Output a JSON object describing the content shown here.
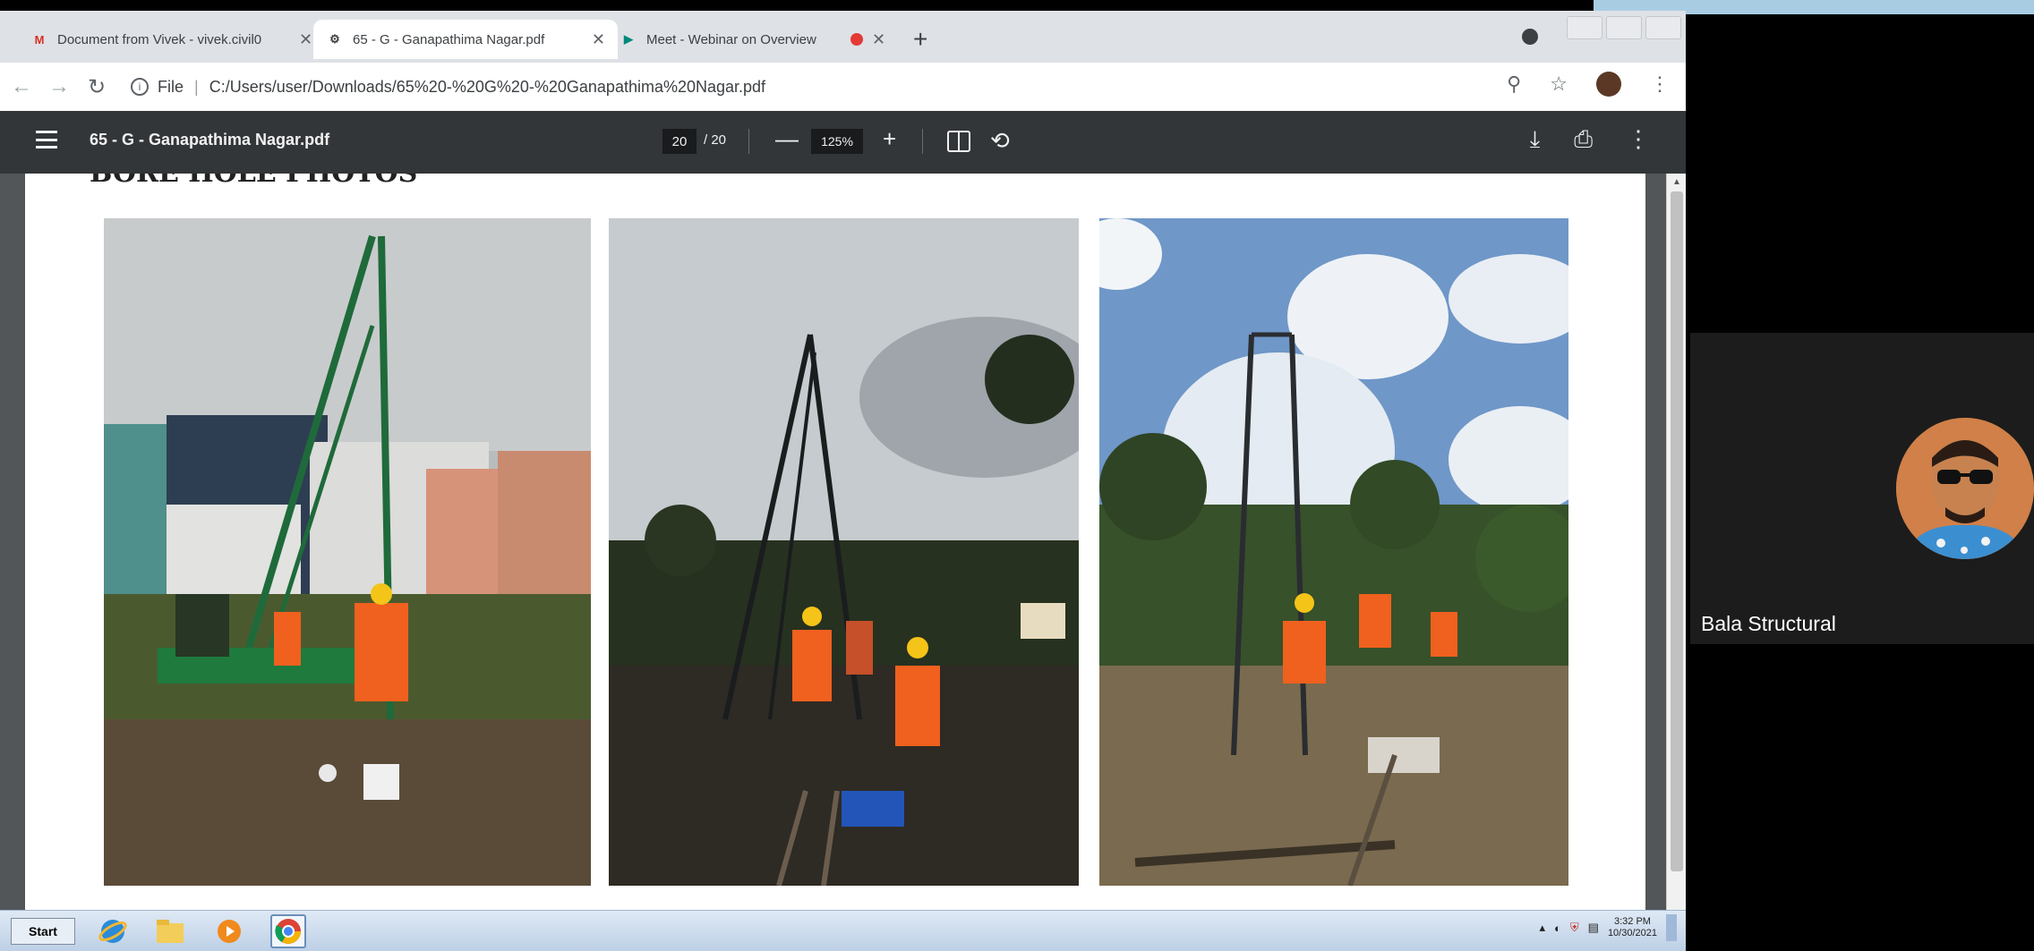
{
  "browser": {
    "tabs": [
      {
        "label": "Document from Vivek - vivek.civil0",
        "icon": "gmail-icon",
        "active": false
      },
      {
        "label": "65 - G - Ganapathima Nagar.pdf",
        "icon": "globe-icon",
        "active": true
      },
      {
        "label": "Meet - Webinar on Overview",
        "icon": "meet-icon",
        "active": false,
        "recording": true
      }
    ],
    "new_tab": "+",
    "url_scheme": "File",
    "url": "C:/Users/user/Downloads/65%20-%20G%20-%20Ganapathima%20Nagar.pdf"
  },
  "pdf": {
    "title": "65 - G - Ganapathima Nagar.pdf",
    "current_page": "20",
    "total_pages": "/ 20",
    "zoom_minus": "—",
    "zoom": "125%",
    "zoom_plus": "+",
    "heading_partial": "BORE HOLE PHOTOS",
    "photos": [
      {
        "name": "site-photo-1"
      },
      {
        "name": "site-photo-2"
      },
      {
        "name": "site-photo-3"
      }
    ]
  },
  "taskbar": {
    "start_label": "Start",
    "clock_time": "3:32 PM",
    "clock_date": "10/30/2021"
  },
  "meeting": {
    "participant_name": "Bala Structural"
  },
  "colors": {
    "tabstrip": "#dee1e6",
    "pdf_toolbar": "#323639",
    "pdf_background": "#525659",
    "meet_tile": "#1c1c1c"
  }
}
